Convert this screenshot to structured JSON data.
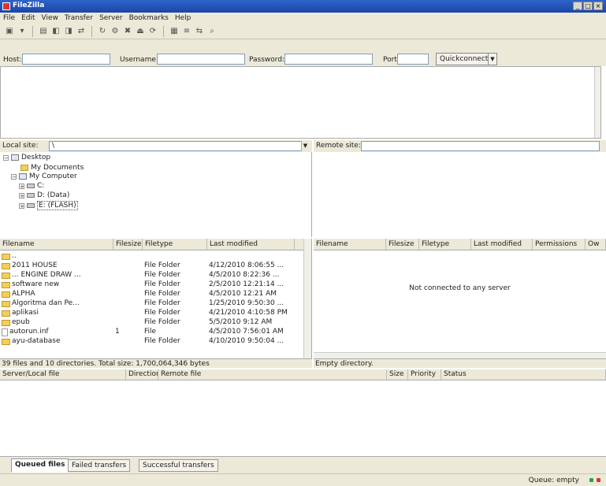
{
  "window": {
    "title": "FileZilla"
  },
  "menu": [
    "File",
    "Edit",
    "View",
    "Transfer",
    "Server",
    "Bookmarks",
    "Help"
  ],
  "quickconnect": {
    "host_label": "Host:",
    "username_label": "Username:",
    "password_label": "Password:",
    "port_label": "Port:",
    "button_label": "Quickconnect"
  },
  "local_site": {
    "label": "Local site:",
    "path": "\\",
    "tree": [
      "Desktop",
      "My Documents",
      "My Computer",
      "C:",
      "D: (Data)",
      "E: (FLASH)"
    ]
  },
  "remote_site": {
    "label": "Remote site:"
  },
  "local_list": {
    "columns": [
      "Filename",
      "Filesize",
      "Filetype",
      "Last modified"
    ],
    "rows": [
      {
        "name": "..",
        "size": "",
        "type": "",
        "modified": "",
        "icon": "up-folder"
      },
      {
        "name": "2011 HOUSE",
        "size": "",
        "type": "File Folder",
        "modified": "4/12/2010 8:06:55 ...",
        "icon": "folder"
      },
      {
        "name": "... ENGINE DRAW ...",
        "size": "",
        "type": "File Folder",
        "modified": "4/5/2010 8:22:36 ...",
        "icon": "folder"
      },
      {
        "name": "software new",
        "size": "",
        "type": "File Folder",
        "modified": "2/5/2010 12:21:14 ...",
        "icon": "folder"
      },
      {
        "name": "ALPHA",
        "size": "",
        "type": "File Folder",
        "modified": "4/5/2010 12:21 AM",
        "icon": "folder"
      },
      {
        "name": "Algoritma dan Pe...",
        "size": "",
        "type": "File Folder",
        "modified": "1/25/2010 9:50:30 ...",
        "icon": "folder"
      },
      {
        "name": "aplikasi",
        "size": "",
        "type": "File Folder",
        "modified": "4/21/2010 4:10:58 PM",
        "icon": "folder"
      },
      {
        "name": "epub",
        "size": "",
        "type": "File Folder",
        "modified": "5/5/2010 9:12 AM",
        "icon": "folder"
      },
      {
        "name": "autorun.inf",
        "size": "1",
        "type": "File",
        "modified": "4/5/2010 7:56:01 AM",
        "icon": "file"
      },
      {
        "name": "ayu-database",
        "size": "",
        "type": "File Folder",
        "modified": "4/10/2010 9:50:04 ...",
        "icon": "folder"
      }
    ]
  },
  "remote_list": {
    "columns": [
      "Filename",
      "Filesize",
      "Filetype",
      "Last modified",
      "Permissions",
      "Ow"
    ],
    "message": "Not connected to any server"
  },
  "local_status": "39 files and 10 directories. Total size: 1,700,064,346 bytes",
  "remote_status": "Empty directory.",
  "queue": {
    "columns": [
      "Server/Local file",
      "Direction",
      "Remote file",
      "Size",
      "Priority",
      "Status"
    ],
    "tabs": [
      "Queued files",
      "Failed transfers",
      "Successful transfers"
    ]
  },
  "statusbar": {
    "queue": "Queue: empty"
  },
  "colors": {
    "titlebar": "#1b45a8",
    "panel": "#ece9d8",
    "folder": "#f2cf5b",
    "led_green": "#2ea043",
    "led_red": "#d33"
  }
}
